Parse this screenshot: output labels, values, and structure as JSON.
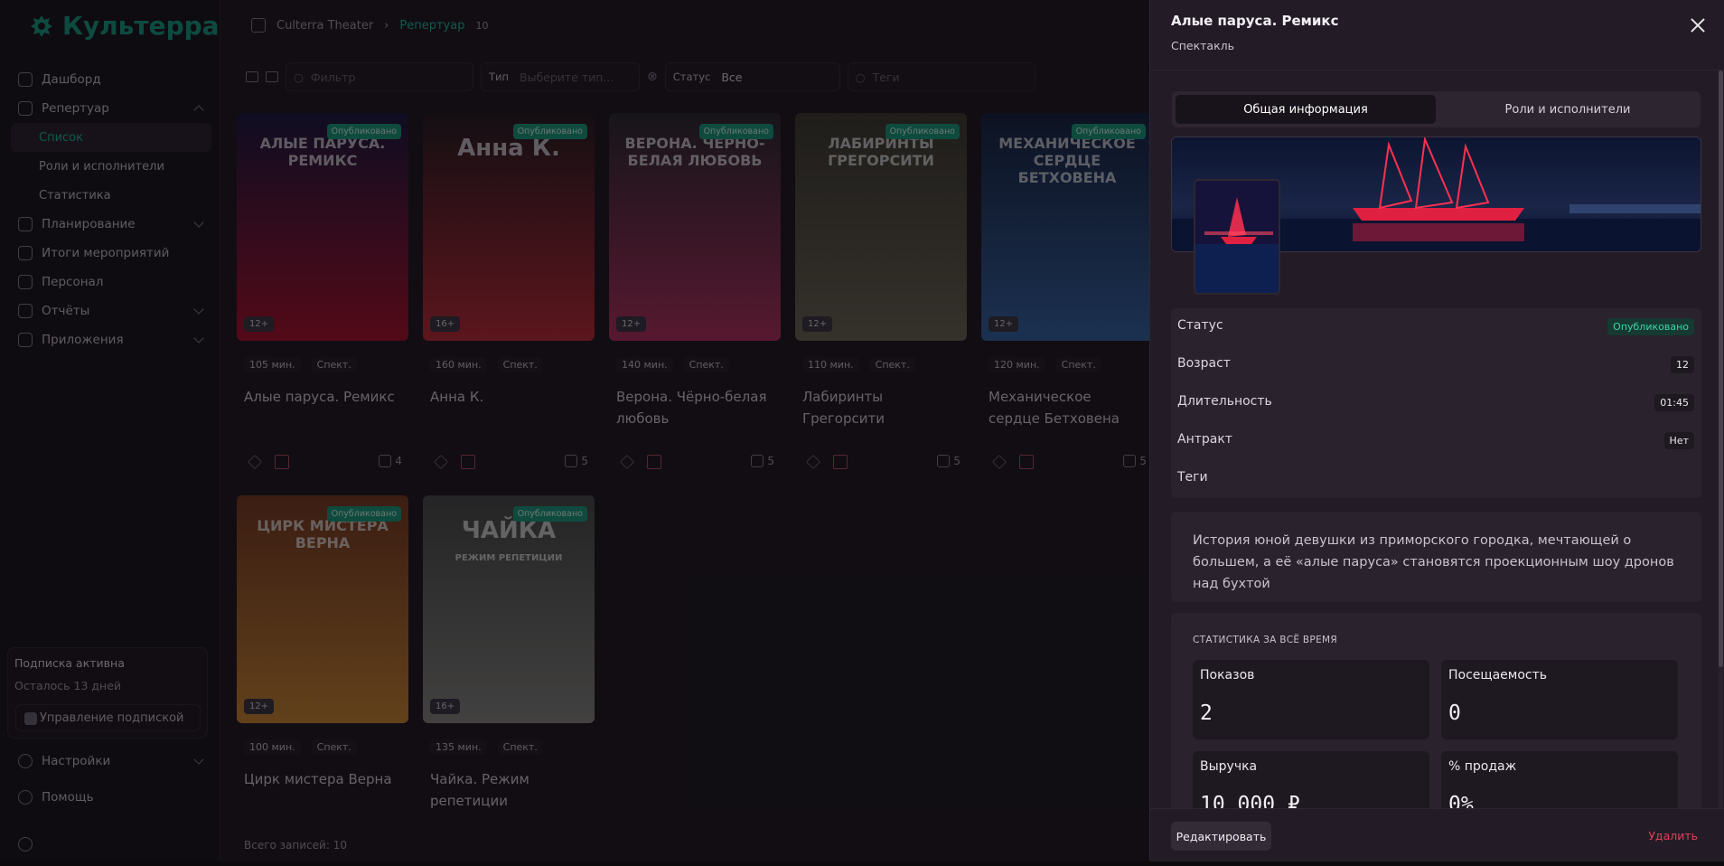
{
  "sidebar": {
    "brand": "Культерра",
    "items": [
      {
        "label": "Дашборд"
      },
      {
        "label": "Репертуар"
      },
      {
        "label": "Список"
      },
      {
        "label": "Роли и исполнители"
      },
      {
        "label": "Статистика"
      },
      {
        "label": "Планирование"
      },
      {
        "label": "Итоги мероприятий"
      },
      {
        "label": "Персонал"
      },
      {
        "label": "Отчёты"
      },
      {
        "label": "Приложения"
      }
    ],
    "subscription": {
      "title": "Подписка активна",
      "remaining": "Осталось 13 дней",
      "manage": "Управление подпиской"
    },
    "settings": "Настройки",
    "help": "Помощь"
  },
  "breadcrumb": {
    "org": "Culterra Theater",
    "current": "Репертуар",
    "count": "10"
  },
  "filters": {
    "search_placeholder": "Фильтр",
    "type_label": "Тип",
    "type_placeholder": "Выберите тип...",
    "status_label": "Статус",
    "status_value": "Все",
    "tags_placeholder": "Теги"
  },
  "cards": [
    {
      "poster_text": "АЛЫЕ ПАРУСА. РЕМИКС",
      "status": "Опубликовано",
      "age": "12+",
      "duration": "105 мин.",
      "kind": "Спект.",
      "title": "Алые паруса. Ремикс",
      "cast": "4",
      "colors": [
        "#1a1740",
        "#b0102a"
      ]
    },
    {
      "poster_text": "Анна К.",
      "status": "Опубликовано",
      "age": "16+",
      "duration": "160 мин.",
      "kind": "Спект.",
      "title": "Анна К.",
      "cast": "5",
      "colors": [
        "#241a20",
        "#c42a35"
      ]
    },
    {
      "poster_text": "ВЕРОНА. ЧЁРНО-БЕЛАЯ ЛЮБОВЬ",
      "status": "Опубликовано",
      "age": "12+",
      "duration": "140 мин.",
      "kind": "Спект.",
      "title": "Верона. Чёрно-белая любовь",
      "cast": "5",
      "colors": [
        "#2a2830",
        "#b8305f"
      ]
    },
    {
      "poster_text": "ЛАБИРИНТЫ ГРЕГОРСИТИ",
      "status": "Опубликовано",
      "age": "12+",
      "duration": "110 мин.",
      "kind": "Спект.",
      "title": "Лабиринты Грегорсити",
      "cast": "5",
      "colors": [
        "#3d3a30",
        "#6d6856"
      ]
    },
    {
      "poster_text": "МЕХАНИЧЕСКОЕ СЕРДЦЕ БЕТХОВЕНА",
      "status": "Опубликовано",
      "age": "12+",
      "duration": "120 мин.",
      "kind": "Спект.",
      "title": "Механическое сердце Бетховена",
      "cast": "5",
      "colors": [
        "#142240",
        "#3566a8"
      ]
    },
    {
      "poster_text": "ЦИРК МИСТЕРА ВЕРНА",
      "status": "Опубликовано",
      "age": "12+",
      "duration": "100 мин.",
      "kind": "Спект.",
      "title": "Цирк мистера Верна",
      "cast": "",
      "colors": [
        "#7a3a20",
        "#d08a30"
      ]
    },
    {
      "poster_text": "ЧАЙКА",
      "poster_sub": "РЕЖИМ РЕПЕТИЦИИ",
      "status": "Опубликовано",
      "age": "16+",
      "duration": "135 мин.",
      "kind": "Спект.",
      "title": "Чайка. Режим репетиции",
      "cast": "",
      "colors": [
        "#4a4a48",
        "#8a8a84"
      ]
    }
  ],
  "total": "Всего записей: 10",
  "drawer": {
    "title": "Алые паруса. Ремикс",
    "subtitle": "Спектакль",
    "tabs": [
      "Общая информация",
      "Роли и исполнители"
    ],
    "fields": [
      {
        "key": "Статус",
        "value": "Опубликовано"
      },
      {
        "key": "Возраст",
        "value": "12"
      },
      {
        "key": "Длительность",
        "value": "01:45"
      },
      {
        "key": "Антракт",
        "value": "Нет"
      },
      {
        "key": "Теги",
        "value": ""
      }
    ],
    "description": "История юной девушки из приморского городка, мечтающей о большем, а её «алые паруса» становятся проекционным шоу дронов над бухтой",
    "stats_heading": "СТАТИСТИКА ЗА ВСЁ ВРЕМЯ",
    "stats": [
      {
        "label": "Показов",
        "value": "2"
      },
      {
        "label": "Посещаемость",
        "value": "0"
      },
      {
        "label": "Выручка",
        "value": "10 000 ₽"
      },
      {
        "label": "% продаж",
        "value": "0%"
      }
    ],
    "edit": "Редактировать",
    "delete": "Удалить"
  },
  "colors": {
    "accent": "#1ec09f",
    "published": "#18a07e",
    "danger": "#e0405b"
  }
}
